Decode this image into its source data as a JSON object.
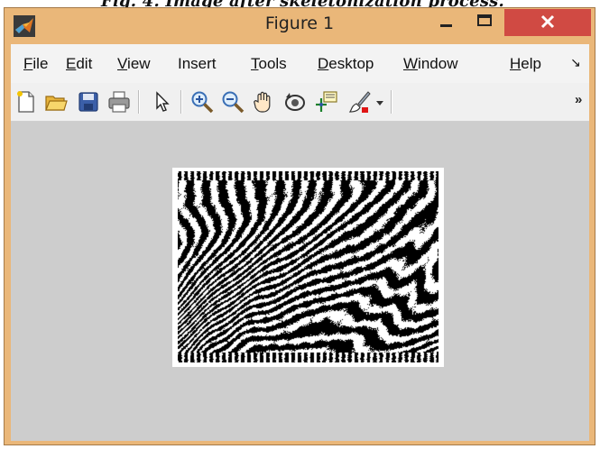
{
  "caption": "Fig. 4. Image after skeletonization process.",
  "window": {
    "title": "Figure 1",
    "controls": {
      "minimize_icon": "minimize-icon",
      "maximize_icon": "maximize-icon",
      "close_icon": "close-icon"
    }
  },
  "menu": {
    "items": [
      {
        "mnemonic": "F",
        "rest": "ile"
      },
      {
        "mnemonic": "E",
        "rest": "dit"
      },
      {
        "mnemonic": "V",
        "rest": "iew"
      },
      {
        "mnemonic": "",
        "rest": "Insert"
      },
      {
        "mnemonic": "T",
        "rest": "ools"
      },
      {
        "mnemonic": "D",
        "rest": "esktop"
      },
      {
        "mnemonic": "W",
        "rest": "indow"
      },
      {
        "mnemonic": "H",
        "rest": "elp"
      }
    ],
    "overflow_icon": "menu-overflow-icon"
  },
  "toolbar": {
    "buttons": [
      "new-figure-icon",
      "open-file-icon",
      "save-icon",
      "print-icon",
      "select-arrow-icon",
      "zoom-in-icon",
      "zoom-out-icon",
      "pan-hand-icon",
      "rotate-3d-icon",
      "data-cursor-icon",
      "brush-icon",
      "dropdown-arrow-icon"
    ],
    "overflow": "»"
  },
  "colors": {
    "titlebar": "#eab779",
    "close_button": "#d04a43",
    "figure_background": "#cdcdcd",
    "image_foreground": "#000000",
    "image_background": "#ffffff"
  },
  "figure": {
    "content": "binary skeletonized fingerprint-like image (black ridges on white)"
  }
}
